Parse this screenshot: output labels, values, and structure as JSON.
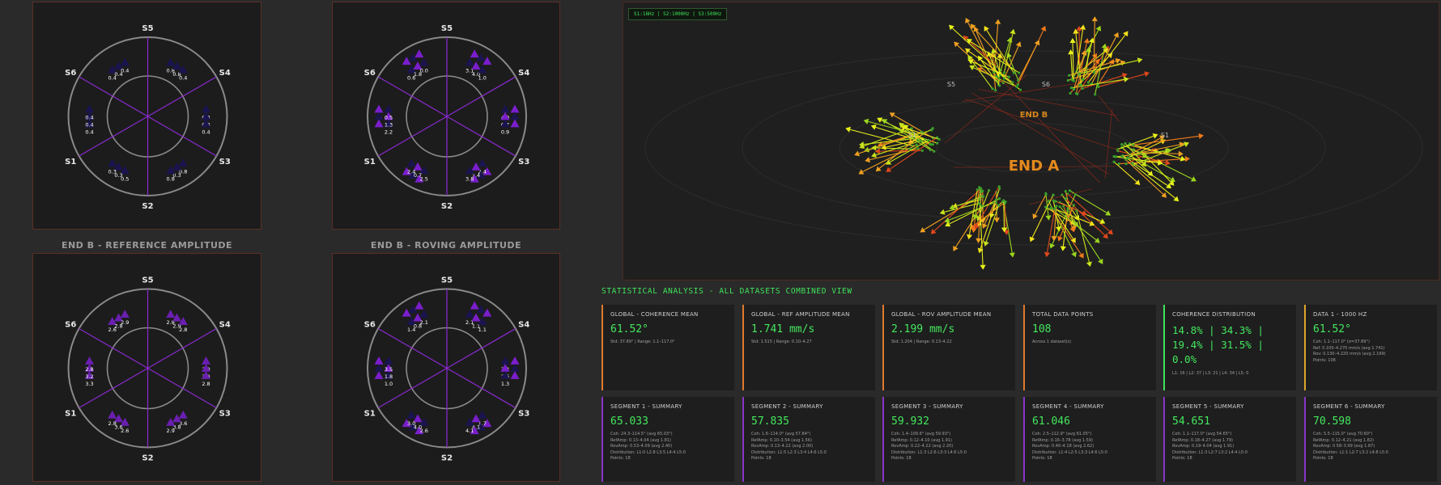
{
  "panels": [
    {
      "id": "end-a-ref",
      "title": "",
      "ticks": [
        [
          [
            "0.8",
            "0.8",
            "0.4"
          ],
          [
            "0.8",
            "0.8",
            "0.4"
          ],
          [
            "0.4",
            "0.4",
            "0.4"
          ]
        ],
        [
          [
            "0.8",
            "0.8",
            "0.4"
          ],
          [
            "0.8",
            "0.8",
            "0.4"
          ],
          [
            "0.4",
            "0.4",
            "0.4"
          ]
        ],
        [
          [
            "0.8",
            "0.3",
            "0.8"
          ]
        ],
        [
          [
            "0.5",
            "0.3",
            "0.3"
          ]
        ],
        [
          [
            "0.4",
            "0.4",
            "0.4"
          ]
        ],
        [
          [
            "0.4",
            "0.4",
            "0.4"
          ]
        ]
      ]
    },
    {
      "id": "end-a-rov",
      "title": "",
      "ticks": [
        [
          [
            "3.1",
            "4.0",
            "1.0"
          ]
        ],
        [
          [
            "4.0",
            "0.7",
            "0.9"
          ]
        ],
        [
          [
            "2.4",
            "1.4",
            "3.8"
          ]
        ],
        [
          [
            "2.5",
            "0.7",
            "2.4"
          ]
        ],
        [
          [
            "2.2",
            "1.3",
            "0.5"
          ]
        ],
        [
          [
            "0.6",
            "1.8",
            "0.0"
          ]
        ]
      ]
    },
    {
      "id": "end-b-ref",
      "title": "END B - REFERENCE AMPLITUDE",
      "ticks": [
        [
          [
            "2.8",
            "2.9",
            "2.8"
          ]
        ],
        [
          [
            "2.9",
            "3.9",
            "2.8"
          ]
        ],
        [
          [
            "3.6",
            "3.8",
            "2.9"
          ]
        ],
        [
          [
            "2.6",
            "3.6",
            "2.8"
          ]
        ],
        [
          [
            "3.3",
            "3.2",
            "2.8"
          ]
        ],
        [
          [
            "2.6",
            "2.8",
            "2.9"
          ]
        ]
      ]
    },
    {
      "id": "end-b-rov",
      "title": "END B - ROVING AMPLITUDE",
      "ticks": [
        [
          [
            "2.1",
            "1.1",
            "1.1"
          ]
        ],
        [
          [
            "3.2",
            "2.6",
            "1.3"
          ]
        ],
        [
          [
            "1.7",
            "4.1",
            "4.1"
          ]
        ],
        [
          [
            "2.6",
            "4.0",
            "3.0"
          ]
        ],
        [
          [
            "1.0",
            "1.8",
            "3.5"
          ]
        ],
        [
          [
            "1.4",
            "0.8",
            "2.1"
          ]
        ]
      ]
    }
  ],
  "viz3d": {
    "legend": "S1:16Hz | S2:1000Hz | S3:500Hz",
    "label_end_a": "END A",
    "label_end_b": "END B",
    "seg_labels": [
      "S1",
      "S2",
      "S3",
      "S4",
      "S5",
      "S6"
    ]
  },
  "stats": {
    "title": "STATISTICAL ANALYSIS - ALL DATASETS COMBINED VIEW",
    "row1": [
      {
        "label": "GLOBAL - COHERENCE MEAN",
        "value": "61.52°",
        "sub": [
          "Std: 37.89° | Range: 1.1–117.0°"
        ],
        "accent": "orange"
      },
      {
        "label": "GLOBAL - REF AMPLITUDE MEAN",
        "value": "1.741 mm/s",
        "sub": [
          "Std: 1.515 | Range: 0.10–4.27"
        ],
        "accent": "orange"
      },
      {
        "label": "GLOBAL - ROV AMPLITUDE MEAN",
        "value": "2.199 mm/s",
        "sub": [
          "Std: 1.204 | Range: 0.13–4.22"
        ],
        "accent": "orange"
      },
      {
        "label": "TOTAL DATA POINTS",
        "value": "108",
        "sub": [
          "Across 1 dataset(s)"
        ],
        "accent": "orange"
      },
      {
        "label": "COHERENCE DISTRIBUTION",
        "value": "14.8% | 34.3% | 19.4% | 31.5% | 0.0%",
        "sub": [
          "L1: 16 | L2: 37 | L3: 21 | L4: 34 | L5: 0"
        ],
        "accent": "green"
      },
      {
        "label": "DATA 1 - 1000 HZ",
        "value": "61.52°",
        "sub": [
          "Coh: 1.1–117.0° (σ=37.89°)",
          "Ref: 0.100–4.270 mm/s (avg 1.741)",
          "Rov: 0.130–4.220 mm/s (avg 2.199)",
          "Points: 108"
        ],
        "accent": "gold"
      }
    ],
    "row2": [
      {
        "label": "SEGMENT 1 - SUMMARY",
        "value": "65.033",
        "sub": [
          "Coh: 24.3–114.5° (avg 65.03°)",
          "RefAmp: 0.13–4.04 (avg 1.81)",
          "RovAmp: 0.53–4.09 (avg 2.40)",
          "Distribution: L1:0 L2:8 L3:5 L4:4 L5:0",
          "Points: 18"
        ],
        "accent": "purple"
      },
      {
        "label": "SEGMENT 2 - SUMMARY",
        "value": "57.835",
        "sub": [
          "Coh: 1.6–114.0° (avg 57.84°)",
          "RefAmp: 0.10–3.54 (avg 1.56)",
          "RovAmp: 0.13–4.22 (avg 2.00)",
          "Distribution: L1:5 L2:3 L3:4 L4:6 L5:0",
          "Points: 18"
        ],
        "accent": "purple"
      },
      {
        "label": "SEGMENT 3 - SUMMARY",
        "value": "59.932",
        "sub": [
          "Coh: 1.4–109.6° (avg 59.93°)",
          "RefAmp: 0.12–4.10 (avg 1.91)",
          "RovAmp: 0.22–4.22 (avg 2.20)",
          "Distribution: L1:3 L2:6 L3:3 L4:6 L5:0",
          "Points: 18"
        ],
        "accent": "purple"
      },
      {
        "label": "SEGMENT 4 - SUMMARY",
        "value": "61.046",
        "sub": [
          "Coh: 2.5–112.9° (avg 61.05°)",
          "RefAmp: 0.16–3.78 (avg 1.59)",
          "RovAmp: 0.40–4.18 (avg 2.62)",
          "Distribution: L1:4 L2:5 L3:3 L4:6 L5:0",
          "Points: 18"
        ],
        "accent": "purple"
      },
      {
        "label": "SEGMENT 5 - SUMMARY",
        "value": "54.651",
        "sub": [
          "Coh: 1.1–117.0° (avg 54.65°)",
          "RefAmp: 0.18–4.27 (avg 1.79)",
          "RovAmp: 0.19–4.04 (avg 1.91)",
          "Distribution: L1:3 L2:7 L3:2 L4:4 L5:0",
          "Points: 18"
        ],
        "accent": "purple"
      },
      {
        "label": "SEGMENT 6 - SUMMARY",
        "value": "70.598",
        "sub": [
          "Coh: 5.5–115.0° (avg 70.60°)",
          "RefAmp: 0.12–4.21 (avg 1.82)",
          "RovAmp: 0.58–3.99 (avg 1.87)",
          "Distribution: L1:1 L2:7 L3:2 L4:8 L5:0",
          "Points: 18"
        ],
        "accent": "purple"
      }
    ]
  },
  "colors": {
    "accent_green": "#3ee35a",
    "accent_orange": "#e0792c",
    "accent_purple": "#8a34c9",
    "triangle_purple": "#6a1fb0",
    "triangle_navy": "#1a1450"
  }
}
